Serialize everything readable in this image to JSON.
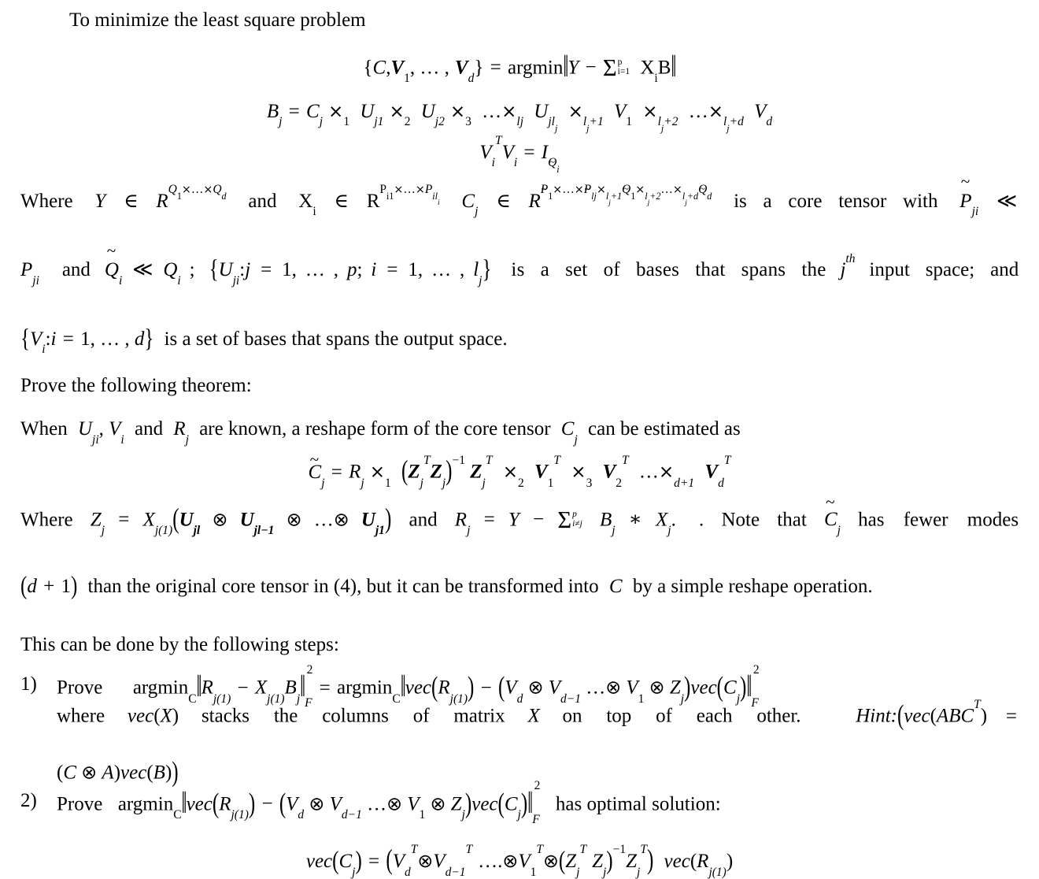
{
  "document": {
    "type": "math-proof-exercise",
    "background_color": "#ffffff",
    "text_color": "#000000",
    "intro_line": "To minimize the least square problem",
    "equations": {
      "eq1": {
        "id": "least-square-objective",
        "lhs": "{C, V₁, …, V_d}",
        "rhs": "argmin ‖Y − Σ_{i=1}^{p} X_i B‖",
        "plain": "{C,V_1,...,V_d} = argmin||Y - sum_{i=1}^{p} X_i B||",
        "sum_lower": "i=1",
        "sum_upper": "p"
      },
      "eq2": {
        "id": "tucker-expansion-Bj",
        "plain": "B_j = C_j ×_1 U_j1 ×_2 U_j2 ×_3 ... ×_lj U_jl_j ×_{l_j+1} V_1 ×_{l_j+2} ... ×_{l_j+d} V_d"
      },
      "eq3": {
        "id": "orthonormality-constraint",
        "plain": "V_i^T V_i = I_{Q̃_i}"
      },
      "eq4": {
        "id": "core-tensor-estimate",
        "plain": "C̃_j = R_j ×_1 (Z_j^T Z_j)^{-1} Z_j^T ×_2 V_1^T ×_3 V_2^T ... ×_{d+1} V_d^T"
      },
      "eq5": {
        "id": "vec-closed-form-solution",
        "plain": "vec(C_j) = (V_d^T ⊗ V_{d-1}^T .... ⊗ V_1^T ⊗ (Z_j^T Z_j)^{-1} Z_j^T) vec(R_{j(1)})"
      }
    },
    "where_paragraph": {
      "id": "definitions-paragraph",
      "segments": {
        "s1": "Where",
        "s2": "and",
        "s3": "is a core tensor with",
        "s4": "and",
        "s5": "is a set of bases that spans the",
        "s6": "input space; and",
        "s7": "is a set of bases that spans the output space."
      },
      "superscript_th": "th"
    },
    "prove_line": "Prove the following theorem:",
    "theorem_line": {
      "s1": "When",
      "s2": ",",
      "s3": "and",
      "s4": "are known, a reshape form of the core tensor",
      "s5": "can be estimated as"
    },
    "where_z_paragraph": {
      "s1": "Where",
      "s2": "and",
      "s3": ". Note that",
      "s4": "has fewer modes",
      "line2_a": "than the original core tensor in (4), but it can be transformed into",
      "line2_b": "by a simple reshape operation."
    },
    "steps_intro": "This can be done by the following steps:",
    "steps": [
      {
        "marker": "1)",
        "verb": "Prove",
        "note_a": "where",
        "note_b": "stacks the columns of matrix",
        "note_c": "on top of each other.",
        "hint_label": "Hint:",
        "hint_body": "(vec(ABC^T) = (C ⊗ A)vec(B))"
      },
      {
        "marker": "2)",
        "verb": "Prove",
        "tail": "has optimal solution:"
      }
    ],
    "symbols": {
      "kronecker": "⊗",
      "mode_product": "×",
      "element_of": "∈",
      "much_less": "≪",
      "minus": "−",
      "asterisk": "∗",
      "not_equal": "≠",
      "ellipsis": "…"
    }
  }
}
